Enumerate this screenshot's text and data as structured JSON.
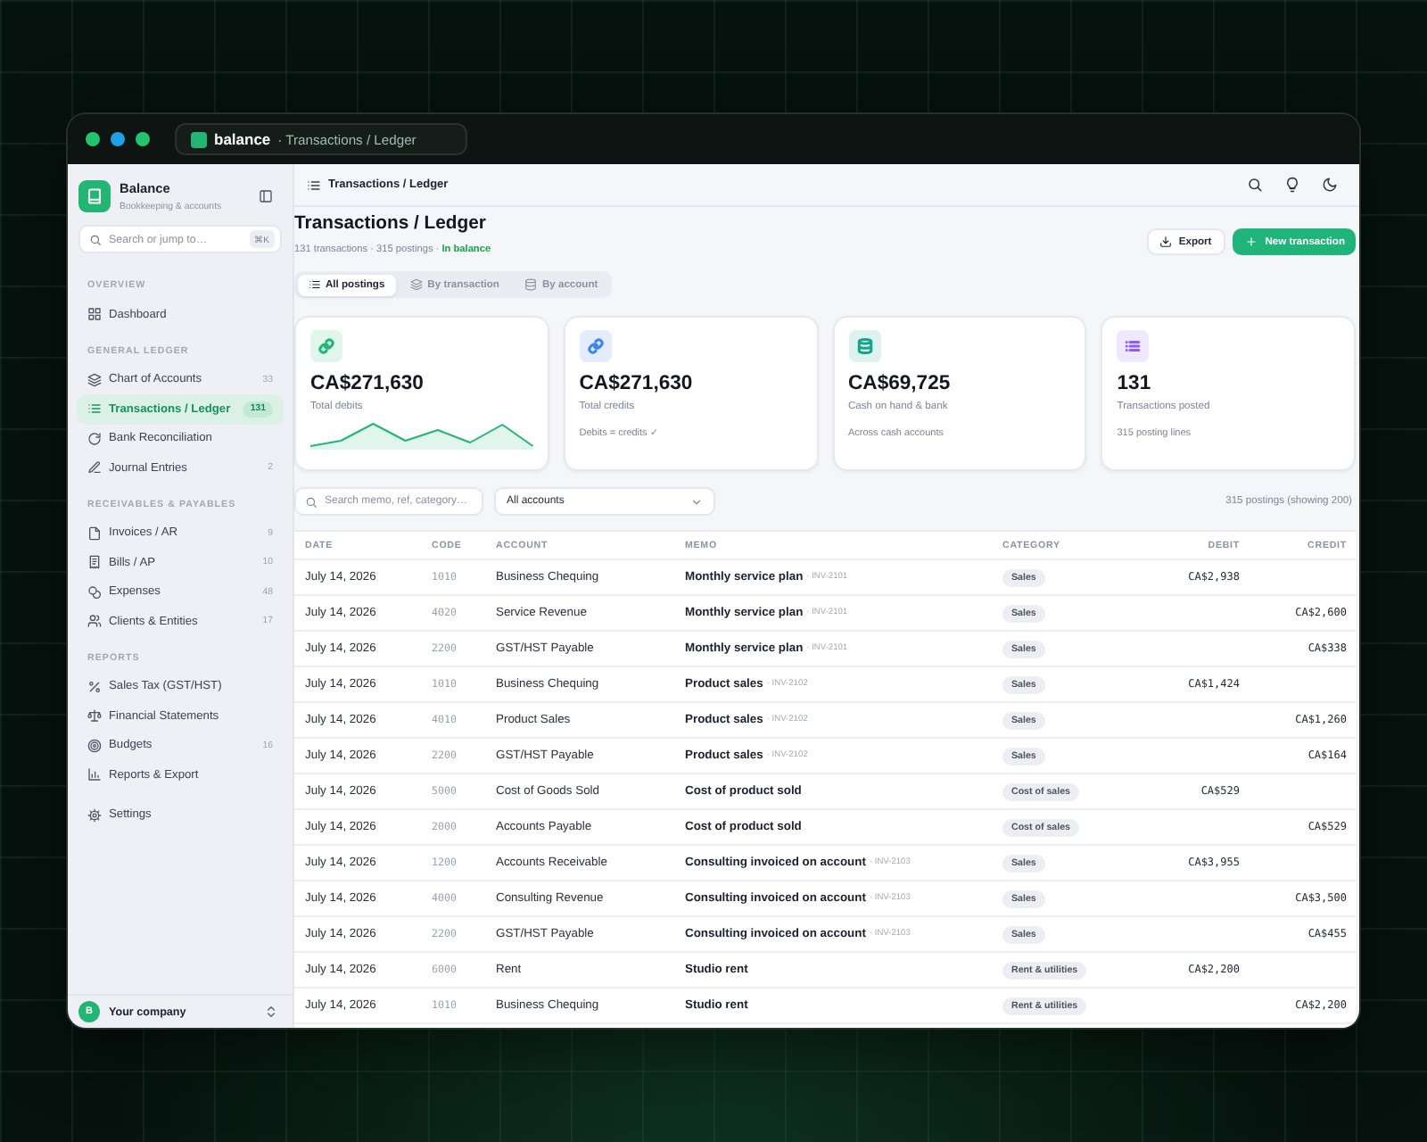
{
  "window": {
    "app_name": "balance",
    "breadcrumb": "· Transactions / Ledger"
  },
  "sidebar": {
    "brand": {
      "name": "Balance",
      "tagline": "Bookkeeping & accounts"
    },
    "search": {
      "placeholder": "Search or jump to…",
      "shortcut": "⌘K"
    },
    "sections": [
      {
        "title": "OVERVIEW",
        "items": [
          {
            "label": "Dashboard",
            "selected": false
          }
        ]
      },
      {
        "title": "GENERAL LEDGER",
        "items": [
          {
            "label": "Chart of Accounts",
            "count": "33",
            "selected": false
          },
          {
            "label": "Transactions / Ledger",
            "count": "131",
            "selected": true
          },
          {
            "label": "Bank Reconciliation",
            "selected": false
          },
          {
            "label": "Journal Entries",
            "count": "2",
            "selected": false
          }
        ]
      },
      {
        "title": "RECEIVABLES & PAYABLES",
        "items": [
          {
            "label": "Invoices / AR",
            "count": "9",
            "selected": false
          },
          {
            "label": "Bills / AP",
            "count": "10",
            "selected": false
          },
          {
            "label": "Expenses",
            "count": "48",
            "selected": false
          },
          {
            "label": "Clients & Entities",
            "count": "17",
            "selected": false
          }
        ]
      },
      {
        "title": "REPORTS",
        "items": [
          {
            "label": "Sales Tax (GST/HST)",
            "selected": false
          },
          {
            "label": "Financial Statements",
            "selected": false
          },
          {
            "label": "Budgets",
            "count": "16",
            "selected": false
          },
          {
            "label": "Reports & Export",
            "selected": false
          }
        ]
      },
      {
        "items": [
          {
            "label": "Settings",
            "selected": false
          }
        ]
      }
    ],
    "footer": {
      "avatar": "B",
      "company": "Your company"
    }
  },
  "topbar": {
    "title": "Transactions / Ledger"
  },
  "page": {
    "title": "Transactions / Ledger",
    "subtitle": "131 transactions · 315 postings · **In balance**",
    "buttons": [
      {
        "label": "Export",
        "kind": "secondary"
      },
      {
        "label": "New transaction",
        "kind": "primary"
      }
    ]
  },
  "view_tabs": [
    {
      "label": "All postings",
      "selected": true
    },
    {
      "label": "By transaction",
      "selected": false
    },
    {
      "label": "By account",
      "selected": false
    }
  ],
  "stat_cards": [
    {
      "kind": "sparkline",
      "color": "#22b573",
      "value": "CA$271,630",
      "label": "Total debits"
    },
    {
      "kind": "note",
      "color": "#3b82f6",
      "value": "CA$271,630",
      "label": "Total credits",
      "note": "Debits = credits ✓"
    },
    {
      "kind": "note",
      "color": "#14a38b",
      "value": "CA$69,725",
      "label": "Cash on hand & bank",
      "note": "Across cash accounts"
    },
    {
      "kind": "note",
      "color": "#8b5cf6",
      "value": "131",
      "label": "Transactions posted",
      "note": "315 posting lines"
    }
  ],
  "filters": {
    "search": {
      "placeholder": "Search memo, ref, category…"
    },
    "account": {
      "value": "All accounts"
    },
    "count": "315 postings (showing 200)"
  },
  "table": {
    "columns": [
      "DATE",
      "CODE",
      "ACCOUNT",
      "MEMO",
      "CATEGORY",
      "DEBIT",
      "CREDIT"
    ],
    "rows": [
      {
        "date": "July 14, 2026",
        "code": "1010",
        "account": "Business Chequing",
        "memo": "Monthly service plan",
        "ref": "· INV-2101",
        "category": "Sales",
        "debit": "CA$2,938"
      },
      {
        "date": "July 14, 2026",
        "code": "4020",
        "account": "Service Revenue",
        "memo": "Monthly service plan",
        "ref": "· INV-2101",
        "category": "Sales",
        "credit": "CA$2,600"
      },
      {
        "date": "July 14, 2026",
        "code": "2200",
        "account": "GST/HST Payable",
        "memo": "Monthly service plan",
        "ref": "· INV-2101",
        "category": "Sales",
        "credit": "CA$338"
      },
      {
        "date": "July 14, 2026",
        "code": "1010",
        "account": "Business Chequing",
        "memo": "Product sales",
        "ref": "· INV-2102",
        "category": "Sales",
        "debit": "CA$1,424"
      },
      {
        "date": "July 14, 2026",
        "code": "4010",
        "account": "Product Sales",
        "memo": "Product sales",
        "ref": "· INV-2102",
        "category": "Sales",
        "credit": "CA$1,260"
      },
      {
        "date": "July 14, 2026",
        "code": "2200",
        "account": "GST/HST Payable",
        "memo": "Product sales",
        "ref": "· INV-2102",
        "category": "Sales",
        "credit": "CA$164"
      },
      {
        "date": "July 14, 2026",
        "code": "5000",
        "account": "Cost of Goods Sold",
        "memo": "Cost of product sold",
        "category": "Cost of sales",
        "debit": "CA$529"
      },
      {
        "date": "July 14, 2026",
        "code": "2000",
        "account": "Accounts Payable",
        "memo": "Cost of product sold",
        "category": "Cost of sales",
        "credit": "CA$529"
      },
      {
        "date": "July 14, 2026",
        "code": "1200",
        "account": "Accounts Receivable",
        "memo": "Consulting invoiced on account",
        "ref": "· INV-2103",
        "category": "Sales",
        "debit": "CA$3,955"
      },
      {
        "date": "July 14, 2026",
        "code": "4000",
        "account": "Consulting Revenue",
        "memo": "Consulting invoiced on account",
        "ref": "· INV-2103",
        "category": "Sales",
        "credit": "CA$3,500"
      },
      {
        "date": "July 14, 2026",
        "code": "2200",
        "account": "GST/HST Payable",
        "memo": "Consulting invoiced on account",
        "ref": "· INV-2103",
        "category": "Sales",
        "credit": "CA$455"
      },
      {
        "date": "July 14, 2026",
        "code": "6000",
        "account": "Rent",
        "memo": "Studio rent",
        "category": "Rent & utilities",
        "debit": "CA$2,200"
      },
      {
        "date": "July 14, 2026",
        "code": "1010",
        "account": "Business Chequing",
        "memo": "Studio rent",
        "category": "Rent & utilities",
        "credit": "CA$2,200"
      }
    ]
  }
}
